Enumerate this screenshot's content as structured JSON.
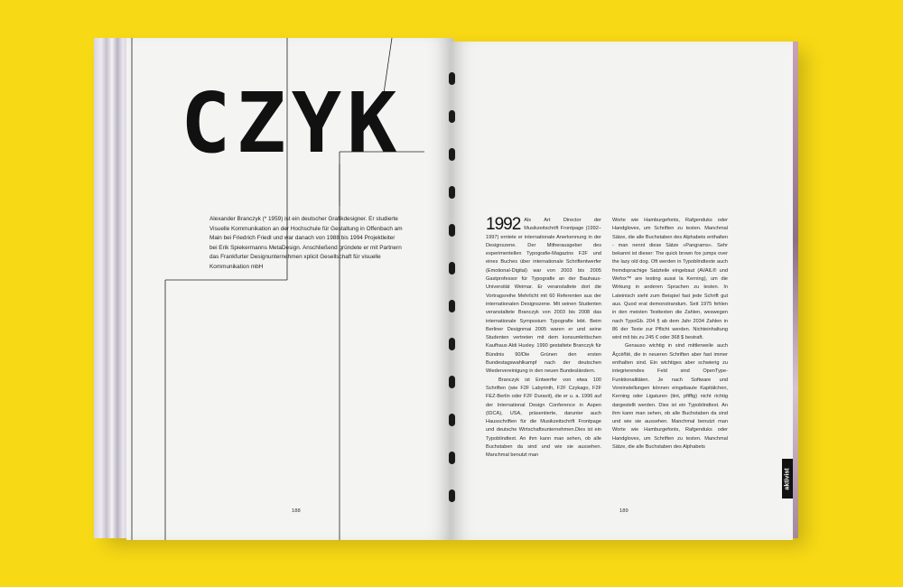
{
  "magazine": {
    "left_page": {
      "title_logo": "CZYK",
      "intro": "Alexander Branczyk (* 1959) ist ein deutscher Grafikdesigner. Er studierte Visuelle Kommunikation an der Hochschule für Gestaltung in Offenbach am Main bei Friedrich Friedl und war danach von 1988 bis 1994 Projektleiter bei Erik Spiekermanns MetaDesign. Anschließend gründete er mit Partnern das Frankfurter Designunternehmen xplicit Gesellschaft für visuelle Kommunikation mbH",
      "page_number": "188"
    },
    "right_page": {
      "year": "1992",
      "col1_p1": "Als Art Director der Musikzeitschrift Frontpage (1992–1997) erntete er internationale Anerkennung in der Designszene. Der Mitherausgeber des experimentellen Typografie-Magazins F2F und eines Buches über internationale Schriftentwerfer (Emotional-Digital) war von 2003 bis 2005 Gastprofessor für Typografie an der Bauhaus-Universität Weimar. Er veranstaltete dort die Vortragsreihe Mehrlicht mit 60 Referenten aus der internationalen Designszene. Mit seinen Studenten veranstaltete Branczyk von 2003 bis 2008 das internationale Symposium Typografie lebt. Beim Berliner Designmai 2005 waren er und seine Studenten vertreten mit dem konsumkritischen Kaufhaus Aldi Huxley. 1990 gestaltete Branczyk für Bündnis 90/Die Grünen den ersten Bundestagswahlkampf nach der deutschen Wiedervereinigung in den neuen Bundesländern.",
      "col1_p2": "Branczyk ist Entwerfer von etwa 100 Schriften (wie F2F Labyrinth, F2F Czykago, F2F FEZ-Berlin oder F2F Duravit), die er u. a. 1996 auf der International Design Conference in Aspen (IDCA), USA, präsentierte, darunter auch Hausschriften für die Musikzeitschrift Frontpage und deutsche Wirtschaftsunternehmen.Dies ist ein Typoblindtext. An ihm kann man sehen, ob alle Buchstaben da sind und wie sie aussehen. Manchmal benutzt man",
      "col2_p1": "Worte wie Hamburgefonts, Rafgenduks oder Handgloves, um Schriften zu testen. Manchmal Sätze, die alle Buchstaben des Alphabets enthalten - man nennt diese Sätze »Pangrams«. Sehr bekannt ist dieser: The quick brown fox jumps over the lazy old dog. Oft werden in Typoblindtexte auch fremdsprachige Satzteile eingebaut (AVAIL® und Wefox™ are testing aussi la Kerning), um die Wirkung in anderen Sprachen zu testen. In Lateinisch sieht zum Beispiel fast jede Schrift gut aus. Quod erat demonstrandum. Seit 1975 fehlen in den meisten Testtexten die Zahlen, weswegen nach TypoGb. 204 § ab dem Jahr 2034 Zahlen in 86 der Texte zur Pflicht werden. Nichteinhaltung wird mit bis zu 245 € oder 368 $ bestraft.",
      "col2_p2": "Genauso wichtig in sind mittlerweile auch Âçcèñtè, die in neueren Schriften aber fast immer enthalten sind. Ein wichtiges aber schwierig zu integrierendes Feld sind OpenType-Funktionalitäten. Je nach Software und Voreinstellungen können eingebaute Kapitälchen, Kerning oder Ligaturen (tint, pfiffig) nicht richtig dargestellt werden. Dies ist ein Typoblindtext. An ihm kann man sehen, ob alle Buchstaben da sind und wie sie aussehen. Manchmal benutzt man Worte wie Hamburgefonts, Rafgenduks oder Handgloves, um Schriften zu testen. Manchmal Sätze, die alle Buchstaben des Alphabets",
      "page_number": "189",
      "side_tab": "aktivist"
    }
  },
  "colors": {
    "background": "#f7d916",
    "paper": "#f4f4f2",
    "ink": "#111111"
  }
}
